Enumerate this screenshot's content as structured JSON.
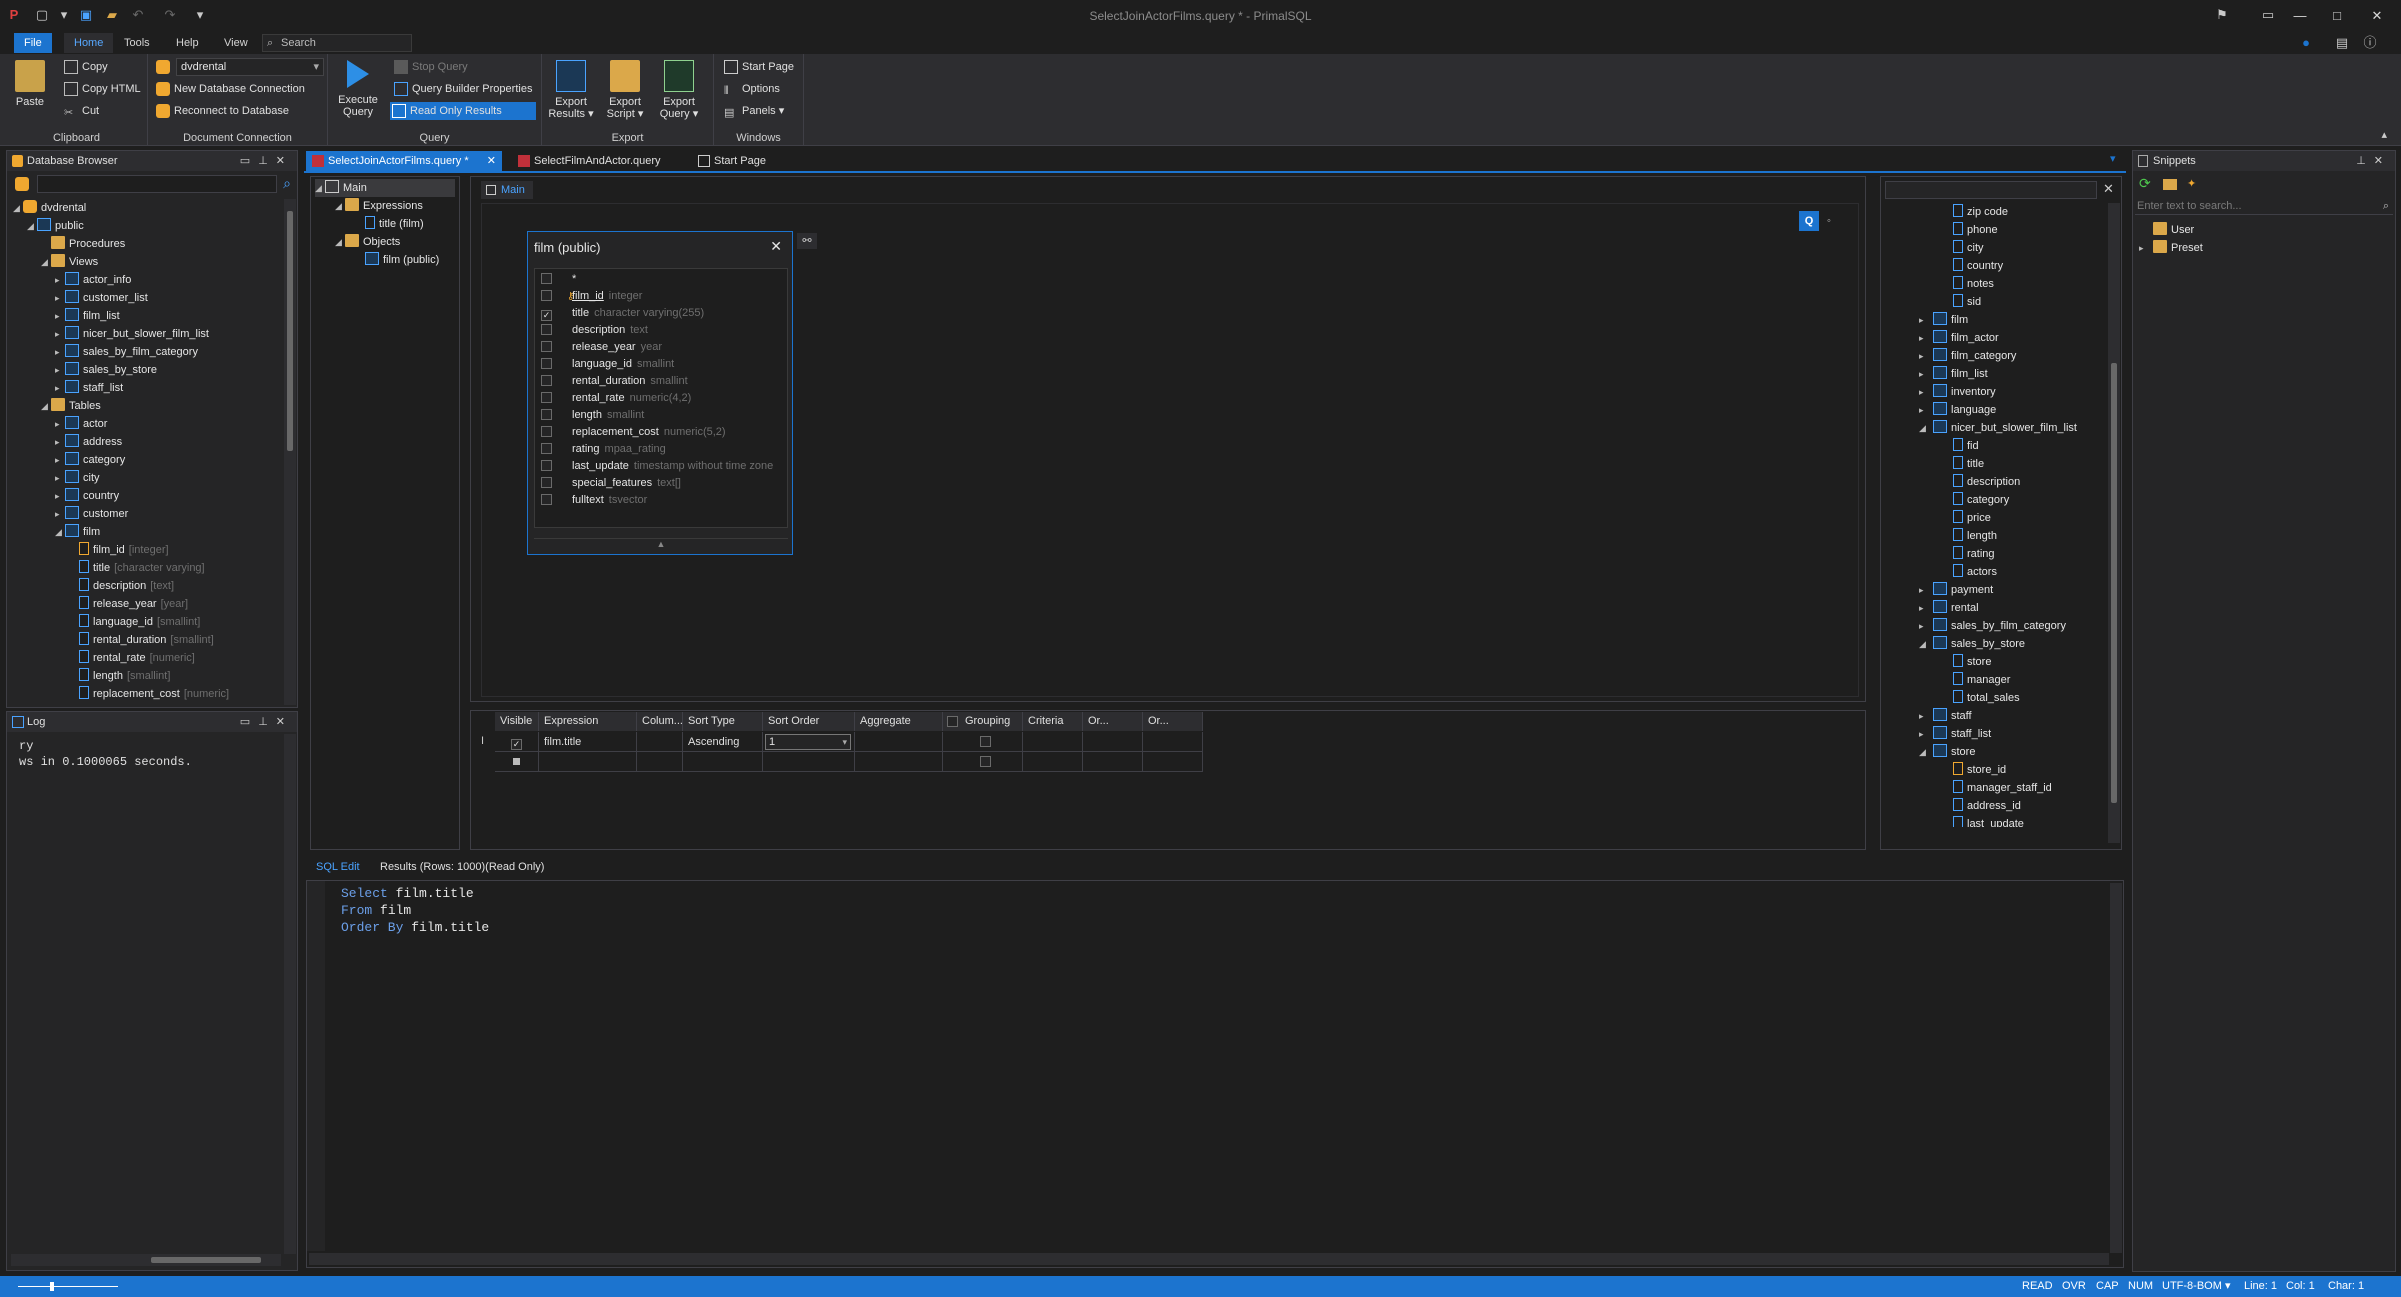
{
  "window": {
    "title": "SelectJoinActorFilms.query * - PrimalSQL",
    "controls": [
      "—",
      "□",
      "✕"
    ]
  },
  "menu": {
    "tabs": [
      "File",
      "Home",
      "Tools",
      "Help",
      "View"
    ],
    "search_placeholder": "Search"
  },
  "ribbon": {
    "clipboard": {
      "label": "Clipboard",
      "paste": "Paste",
      "copy": "Copy",
      "copy_html": "Copy HTML",
      "cut": "Cut"
    },
    "connection": {
      "label": "Document Connection",
      "db_value": "dvdrental",
      "new_conn": "New Database Connection",
      "reconnect": "Reconnect to Database"
    },
    "query": {
      "label": "Query",
      "execute_line1": "Execute",
      "execute_line2": "Query",
      "stop": "Stop Query",
      "qb_props": "Query Builder Properties",
      "read_only": "Read Only Results"
    },
    "export": {
      "label": "Export",
      "results_line1": "Export",
      "results_line2": "Results",
      "script_line1": "Export",
      "script_line2": "Script",
      "query_line1": "Export",
      "query_line2": "Query"
    },
    "windows": {
      "label": "Windows",
      "start_page": "Start Page",
      "options": "Options",
      "panels": "Panels"
    }
  },
  "db_browser": {
    "title": "Database Browser",
    "tree": [
      {
        "text": "dvdrental",
        "level": 0,
        "icon": "db",
        "exp": "◢"
      },
      {
        "text": "public",
        "level": 1,
        "icon": "schema",
        "exp": "◢"
      },
      {
        "text": "Procedures",
        "level": 2,
        "icon": "folder",
        "exp": ""
      },
      {
        "text": "Views",
        "level": 2,
        "icon": "folder",
        "exp": "◢"
      },
      {
        "text": "actor_info",
        "level": 3,
        "icon": "view",
        "exp": "▸"
      },
      {
        "text": "customer_list",
        "level": 3,
        "icon": "view",
        "exp": "▸"
      },
      {
        "text": "film_list",
        "level": 3,
        "icon": "view",
        "exp": "▸"
      },
      {
        "text": "nicer_but_slower_film_list",
        "level": 3,
        "icon": "view",
        "exp": "▸"
      },
      {
        "text": "sales_by_film_category",
        "level": 3,
        "icon": "view",
        "exp": "▸"
      },
      {
        "text": "sales_by_store",
        "level": 3,
        "icon": "view",
        "exp": "▸"
      },
      {
        "text": "staff_list",
        "level": 3,
        "icon": "view",
        "exp": "▸"
      },
      {
        "text": "Tables",
        "level": 2,
        "icon": "folder",
        "exp": "◢"
      },
      {
        "text": "actor",
        "level": 3,
        "icon": "table",
        "exp": "▸"
      },
      {
        "text": "address",
        "level": 3,
        "icon": "table",
        "exp": "▸"
      },
      {
        "text": "category",
        "level": 3,
        "icon": "table",
        "exp": "▸"
      },
      {
        "text": "city",
        "level": 3,
        "icon": "table",
        "exp": "▸"
      },
      {
        "text": "country",
        "level": 3,
        "icon": "table",
        "exp": "▸"
      },
      {
        "text": "customer",
        "level": 3,
        "icon": "table",
        "exp": "▸"
      },
      {
        "text": "film",
        "level": 3,
        "icon": "table",
        "exp": "◢"
      },
      {
        "text": "film_id",
        "type": "[integer]",
        "level": 4,
        "icon": "key",
        "exp": ""
      },
      {
        "text": "title",
        "type": "[character varying]",
        "level": 4,
        "icon": "col",
        "exp": ""
      },
      {
        "text": "description",
        "type": "[text]",
        "level": 4,
        "icon": "col",
        "exp": ""
      },
      {
        "text": "release_year",
        "type": "[year]",
        "level": 4,
        "icon": "col",
        "exp": ""
      },
      {
        "text": "language_id",
        "type": "[smallint]",
        "level": 4,
        "icon": "col",
        "exp": ""
      },
      {
        "text": "rental_duration",
        "type": "[smallint]",
        "level": 4,
        "icon": "col",
        "exp": ""
      },
      {
        "text": "rental_rate",
        "type": "[numeric]",
        "level": 4,
        "icon": "col",
        "exp": ""
      },
      {
        "text": "length",
        "type": "[smallint]",
        "level": 4,
        "icon": "col",
        "exp": ""
      },
      {
        "text": "replacement_cost",
        "type": "[numeric]",
        "level": 4,
        "icon": "col",
        "exp": ""
      }
    ]
  },
  "log": {
    "title": "Log",
    "lines": [
      "ry",
      "ws in 0.1000065 seconds."
    ]
  },
  "doc_tabs": [
    "SelectJoinActorFilms.query *",
    "SelectFilmAndActor.query",
    "Start Page"
  ],
  "qb_tree": {
    "root": "Main",
    "expressions": "Expressions",
    "expr_item": "title (film)",
    "objects": "Objects",
    "obj_item": "film (public)"
  },
  "qb": {
    "main_tab": "Main",
    "table_box_title": "film (public)",
    "fields": [
      {
        "name": "*",
        "type": "",
        "checked": false,
        "key": false
      },
      {
        "name": "film_id",
        "type": "integer",
        "checked": false,
        "key": true
      },
      {
        "name": "title",
        "type": "character varying(255)",
        "checked": true,
        "key": false
      },
      {
        "name": "description",
        "type": "text",
        "checked": false,
        "key": false
      },
      {
        "name": "release_year",
        "type": "year",
        "checked": false,
        "key": false
      },
      {
        "name": "language_id",
        "type": "smallint",
        "checked": false,
        "key": false
      },
      {
        "name": "rental_duration",
        "type": "smallint",
        "checked": false,
        "key": false
      },
      {
        "name": "rental_rate",
        "type": "numeric(4,2)",
        "checked": false,
        "key": false
      },
      {
        "name": "length",
        "type": "smallint",
        "checked": false,
        "key": false
      },
      {
        "name": "replacement_cost",
        "type": "numeric(5,2)",
        "checked": false,
        "key": false
      },
      {
        "name": "rating",
        "type": "mpaa_rating",
        "checked": false,
        "key": false
      },
      {
        "name": "last_update",
        "type": "timestamp without time zone",
        "checked": false,
        "key": false
      },
      {
        "name": "special_features",
        "type": "text[]",
        "checked": false,
        "key": false
      },
      {
        "name": "fulltext",
        "type": "tsvector",
        "checked": false,
        "key": false
      }
    ],
    "grid_headers": [
      "Visible",
      "Expression",
      "Colum...",
      "Sort Type",
      "Sort Order",
      "Aggregate",
      "Grouping",
      "Criteria",
      "Or...",
      "Or..."
    ],
    "grid_row": {
      "expression": "film.title",
      "sort_type": "Ascending",
      "sort_order": "1"
    }
  },
  "schema_tree": [
    {
      "text": "zip code",
      "level": 2,
      "icon": "col"
    },
    {
      "text": "phone",
      "level": 2,
      "icon": "col"
    },
    {
      "text": "city",
      "level": 2,
      "icon": "col"
    },
    {
      "text": "country",
      "level": 2,
      "icon": "col"
    },
    {
      "text": "notes",
      "level": 2,
      "icon": "col"
    },
    {
      "text": "sid",
      "level": 2,
      "icon": "col"
    },
    {
      "text": "film",
      "level": 1,
      "icon": "table",
      "exp": "▸"
    },
    {
      "text": "film_actor",
      "level": 1,
      "icon": "table",
      "exp": "▸"
    },
    {
      "text": "film_category",
      "level": 1,
      "icon": "table",
      "exp": "▸"
    },
    {
      "text": "film_list",
      "level": 1,
      "icon": "view",
      "exp": "▸"
    },
    {
      "text": "inventory",
      "level": 1,
      "icon": "table",
      "exp": "▸"
    },
    {
      "text": "language",
      "level": 1,
      "icon": "table",
      "exp": "▸"
    },
    {
      "text": "nicer_but_slower_film_list",
      "level": 1,
      "icon": "view",
      "exp": "◢"
    },
    {
      "text": "fid",
      "level": 2,
      "icon": "col"
    },
    {
      "text": "title",
      "level": 2,
      "icon": "col"
    },
    {
      "text": "description",
      "level": 2,
      "icon": "col"
    },
    {
      "text": "category",
      "level": 2,
      "icon": "col"
    },
    {
      "text": "price",
      "level": 2,
      "icon": "col"
    },
    {
      "text": "length",
      "level": 2,
      "icon": "col"
    },
    {
      "text": "rating",
      "level": 2,
      "icon": "col"
    },
    {
      "text": "actors",
      "level": 2,
      "icon": "col"
    },
    {
      "text": "payment",
      "level": 1,
      "icon": "table",
      "exp": "▸"
    },
    {
      "text": "rental",
      "level": 1,
      "icon": "table",
      "exp": "▸"
    },
    {
      "text": "sales_by_film_category",
      "level": 1,
      "icon": "view",
      "exp": "▸"
    },
    {
      "text": "sales_by_store",
      "level": 1,
      "icon": "view",
      "exp": "◢"
    },
    {
      "text": "store",
      "level": 2,
      "icon": "col"
    },
    {
      "text": "manager",
      "level": 2,
      "icon": "col"
    },
    {
      "text": "total_sales",
      "level": 2,
      "icon": "col"
    },
    {
      "text": "staff",
      "level": 1,
      "icon": "table",
      "exp": "▸"
    },
    {
      "text": "staff_list",
      "level": 1,
      "icon": "view",
      "exp": "▸"
    },
    {
      "text": "store",
      "level": 1,
      "icon": "table",
      "exp": "◢"
    },
    {
      "text": "store_id",
      "level": 2,
      "icon": "key"
    },
    {
      "text": "manager_staff_id",
      "level": 2,
      "icon": "col"
    },
    {
      "text": "address_id",
      "level": 2,
      "icon": "col"
    },
    {
      "text": "last_update",
      "level": 2,
      "icon": "col"
    }
  ],
  "bottom_tabs": [
    "SQL Edit",
    "Results (Rows: 1000)(Read Only)"
  ],
  "sql": [
    {
      "kw": "Select",
      "rest": " film.title"
    },
    {
      "kw": "From",
      "rest": " film"
    },
    {
      "kw": "Order By",
      "rest": " film.title"
    }
  ],
  "snippets": {
    "title": "Snippets",
    "search_placeholder": "Enter text to search...",
    "items": [
      "User",
      "Preset"
    ]
  },
  "status": {
    "items": [
      "READ",
      "OVR",
      "CAP",
      "NUM",
      "UTF-8-BOM",
      "Line: 1",
      "Col: 1",
      "Char: 1"
    ]
  },
  "colors": {
    "accent": "#1c74cf",
    "bg": "#1e1e1e",
    "panel": "#252526",
    "keyword": "#6b9fe8"
  }
}
